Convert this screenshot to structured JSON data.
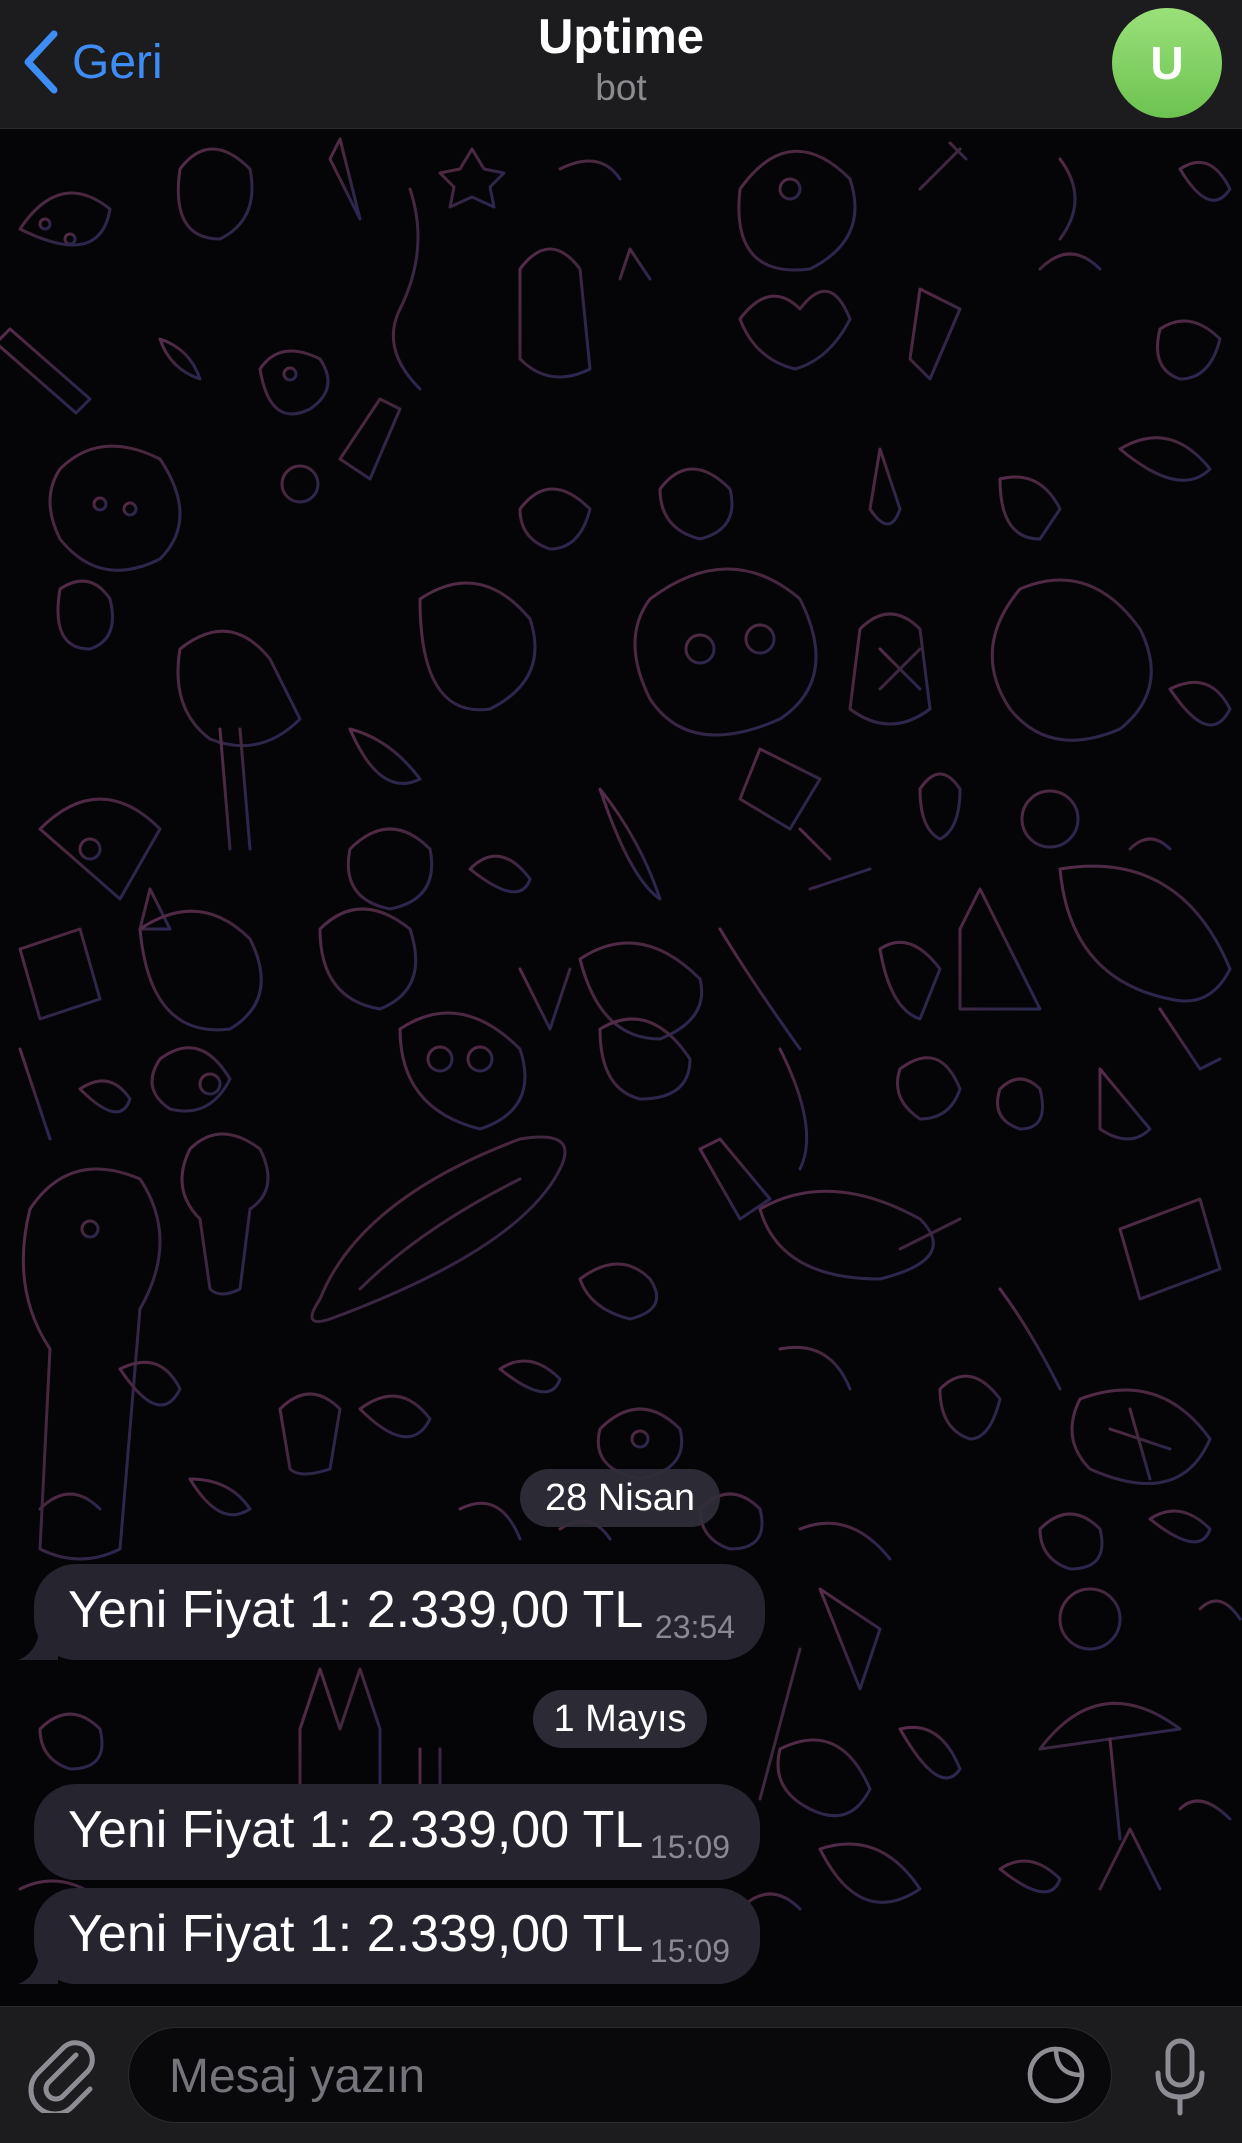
{
  "header": {
    "back_label": "Geri",
    "title": "Uptime",
    "subtitle": "bot",
    "avatar_letter": "U",
    "avatar_color": "#7fd161",
    "accent_color": "#3e8df5"
  },
  "chat": {
    "groups": [
      {
        "date": "28 Nisan",
        "messages": [
          {
            "text": "Yeni Fiyat 1: 2.339,00 TL",
            "time": "23:54"
          }
        ]
      },
      {
        "date": "1 Mayıs",
        "messages": [
          {
            "text": "Yeni Fiyat 1: 2.339,00 TL",
            "time": "15:09"
          },
          {
            "text": "Yeni Fiyat 1: 2.339,00 TL",
            "time": "15:09"
          }
        ]
      }
    ]
  },
  "input_bar": {
    "placeholder": "Mesaj yazın",
    "icons": [
      "paperclip-icon",
      "sticker-icon",
      "microphone-icon"
    ]
  }
}
